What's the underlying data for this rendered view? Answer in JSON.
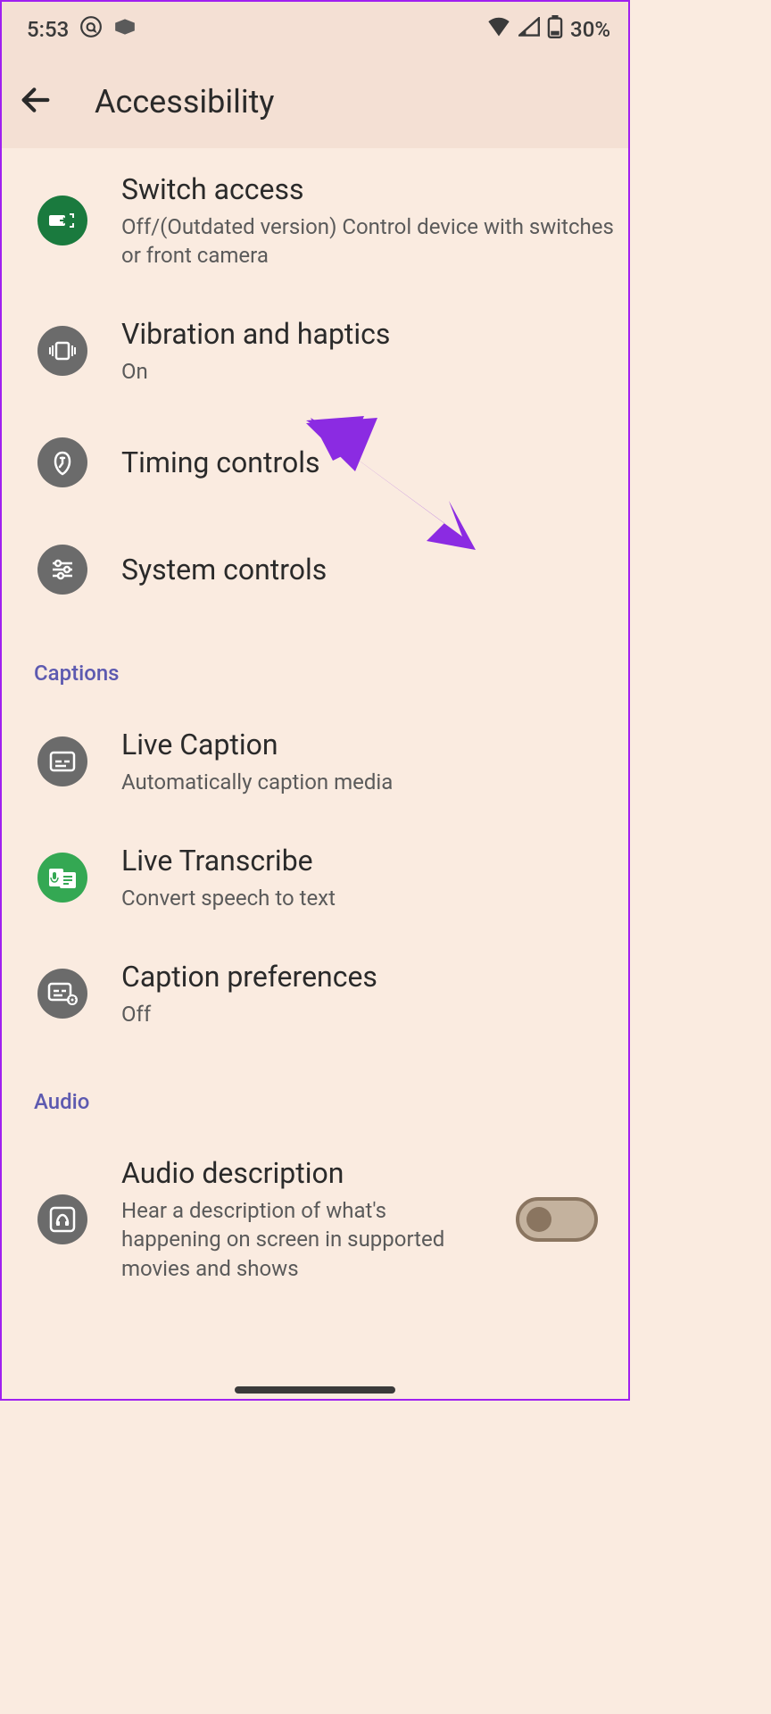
{
  "status": {
    "time": "5:53",
    "battery": "30%"
  },
  "header": {
    "title": "Accessibility"
  },
  "items": {
    "switch_access": {
      "title": "Switch access",
      "sub": "Off/(Outdated version) Control device with switches or front camera"
    },
    "vibration": {
      "title": "Vibration and haptics",
      "sub": "On"
    },
    "timing": {
      "title": "Timing controls"
    },
    "system": {
      "title": "System controls"
    },
    "live_caption": {
      "title": "Live Caption",
      "sub": "Automatically caption media"
    },
    "live_transcribe": {
      "title": "Live Transcribe",
      "sub": "Convert speech to text"
    },
    "caption_pref": {
      "title": "Caption preferences",
      "sub": "Off"
    },
    "audio_desc": {
      "title": "Audio description",
      "sub": "Hear a description of what's happening on screen in supported movies and shows"
    }
  },
  "sections": {
    "captions": "Captions",
    "audio": "Audio"
  }
}
